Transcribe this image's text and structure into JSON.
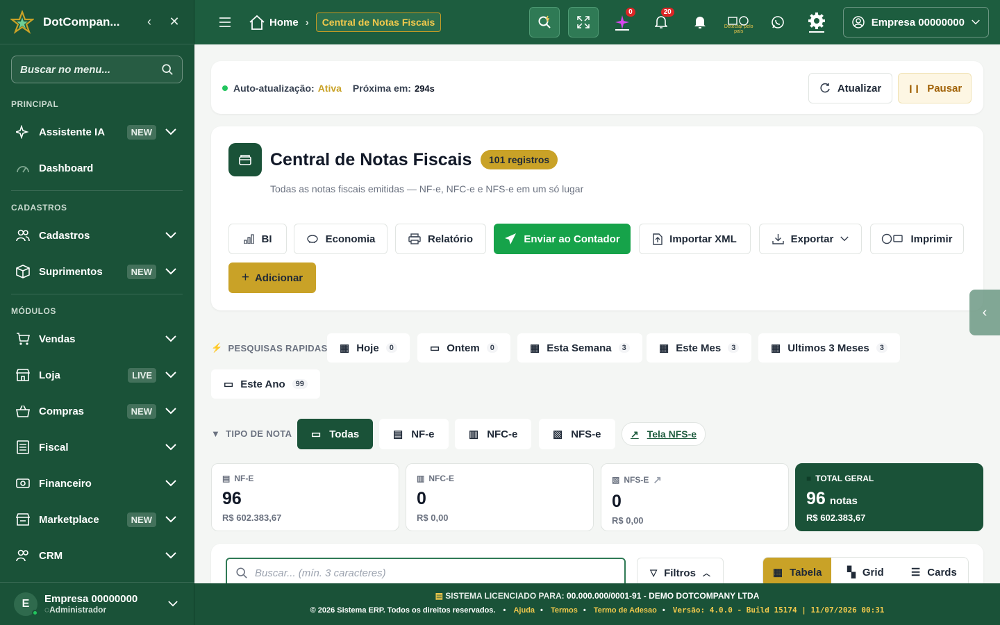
{
  "sidebar": {
    "brand": "DotCompan...",
    "search_placeholder": "Buscar no menu...",
    "sections": {
      "principal": "PRINCIPAL",
      "cadastros": "CADASTROS",
      "modulos": "MÓDULOS"
    },
    "items": [
      {
        "label": "Assistente IA",
        "badge": "NEW"
      },
      {
        "label": "Dashboard",
        "badge": ""
      },
      {
        "label": "Cadastros",
        "badge": ""
      },
      {
        "label": "Suprimentos",
        "badge": "NEW"
      },
      {
        "label": "Vendas",
        "badge": ""
      },
      {
        "label": "Loja",
        "badge": "LIVE"
      },
      {
        "label": "Compras",
        "badge": "NEW"
      },
      {
        "label": "Fiscal",
        "badge": ""
      },
      {
        "label": "Financeiro",
        "badge": ""
      },
      {
        "label": "Marketplace",
        "badge": "NEW"
      },
      {
        "label": "CRM",
        "badge": ""
      }
    ],
    "user": {
      "initial": "E",
      "name": "Empresa 00000000",
      "role": "Administrador"
    }
  },
  "topbar": {
    "home": "Home",
    "current": "Central de Notas Fiscais",
    "ai_count": "0",
    "notif_count": "20",
    "detect_label": "Detectar pelo país",
    "company": "Empresa 00000000"
  },
  "auto": {
    "label": "Auto-atualização:",
    "status": "Ativa",
    "next_label": "Próxima em:",
    "next_value": "294s",
    "refresh": "Atualizar",
    "pause": "Pausar"
  },
  "header": {
    "title": "Central de Notas Fiscais",
    "badge": "101 registros",
    "subtitle": "Todas as notas fiscais emitidas — NF-e, NFC-e e NFS-e em um só lugar",
    "actions": {
      "bi": "BI",
      "economia": "Economia",
      "relatorio": "Relatório",
      "enviar": "Enviar ao Contador",
      "importar": "Importar XML",
      "exportar": "Exportar",
      "imprimir": "Imprimir",
      "adicionar": "Adicionar"
    }
  },
  "quick": {
    "label": "PESQUISAS RAPIDAS",
    "chips": [
      {
        "label": "Hoje",
        "count": "0"
      },
      {
        "label": "Ontem",
        "count": "0"
      },
      {
        "label": "Esta Semana",
        "count": "3"
      },
      {
        "label": "Este Mes",
        "count": "3"
      },
      {
        "label": "Ultimos 3 Meses",
        "count": "3"
      },
      {
        "label": "Este Ano",
        "count": "99"
      }
    ]
  },
  "types": {
    "label": "TIPO DE NOTA",
    "all": "Todas",
    "nfe": "NF-e",
    "nfce": "NFC-e",
    "nfse": "NFS-e",
    "link": "Tela NFS-e"
  },
  "stats": {
    "nfe": {
      "label": "NF-E",
      "count": "96",
      "value": "R$ 602.383,67"
    },
    "nfce": {
      "label": "NFC-E",
      "count": "0",
      "value": "R$ 0,00"
    },
    "nfse": {
      "label": "NFS-E",
      "count": "0",
      "value": "R$ 0,00"
    },
    "total": {
      "label": "TOTAL GERAL",
      "count": "96",
      "unit": "notas",
      "value": "R$ 602.383,67"
    }
  },
  "list": {
    "search_placeholder": "Buscar... (mín. 3 caracteres)",
    "filters": "Filtros",
    "view_table": "Tabela",
    "view_grid": "Grid",
    "view_cards": "Cards"
  },
  "footer": {
    "license_label": "SISTEMA LICENCIADO PARA:",
    "license_value": "00.000.000/0001-91 - DEMO DOTCOMPANY LTDA",
    "copyright": "© 2026 Sistema ERP. Todos os direitos reservados.",
    "help": "Ajuda",
    "terms": "Termos",
    "adhesion": "Termo de Adesao",
    "version": "Versão: 4.0.0 - Build 15174 | 11/07/2026 00:31"
  },
  "colors": {
    "primary": "#1a5238",
    "accent": "#c9a227",
    "success": "#16a34a"
  }
}
